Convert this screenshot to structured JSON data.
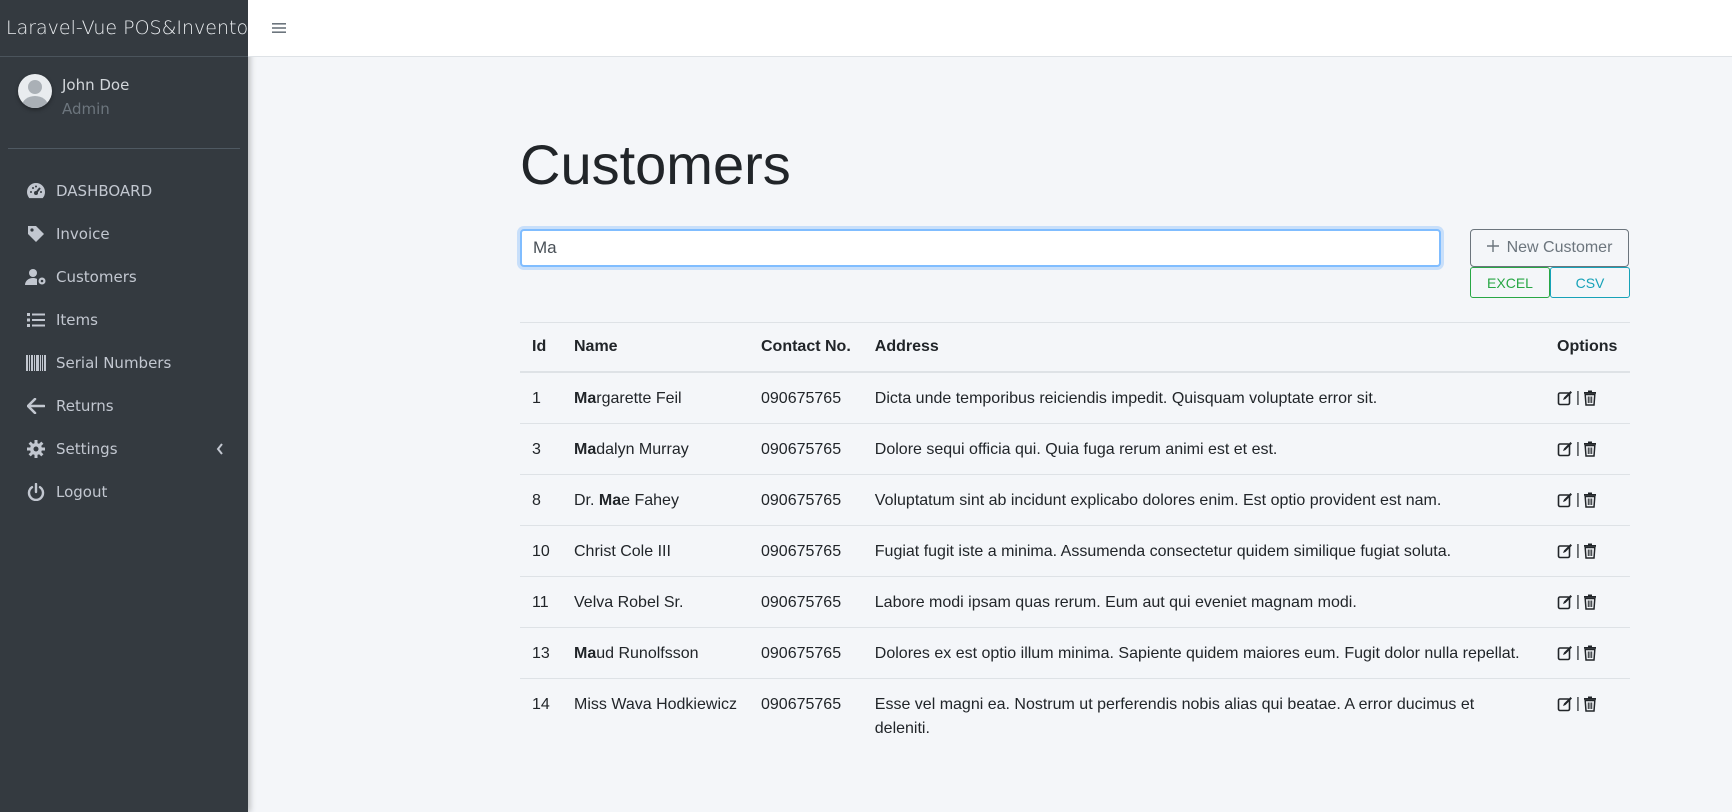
{
  "app": {
    "brand": "Laravel-Vue POS&Inventory"
  },
  "user": {
    "name": "John Doe",
    "role": "Admin"
  },
  "sidebar": {
    "items": [
      {
        "label": "DASHBOARD",
        "icon": "tachometer-icon"
      },
      {
        "label": "Invoice",
        "icon": "tag-icon"
      },
      {
        "label": "Customers",
        "icon": "user-cog-icon"
      },
      {
        "label": "Items",
        "icon": "list-icon"
      },
      {
        "label": "Serial Numbers",
        "icon": "barcode-icon"
      },
      {
        "label": "Returns",
        "icon": "arrow-left-icon"
      },
      {
        "label": "Settings",
        "icon": "gear-icon"
      },
      {
        "label": "Logout",
        "icon": "power-icon"
      }
    ]
  },
  "main": {
    "title": "Customers",
    "search_value": "Ma",
    "new_button": "New Customer",
    "excel_button": "EXCEL",
    "csv_button": "CSV"
  },
  "table": {
    "headers": [
      "Id",
      "Name",
      "Contact No.",
      "Address",
      "Options"
    ],
    "rows": [
      {
        "id": "1",
        "name_pre": "",
        "name_match": "Ma",
        "name_post": "rgarette Feil",
        "contact": "090675765",
        "address": "Dicta unde temporibus reiciendis impedit. Quisquam voluptate error sit."
      },
      {
        "id": "3",
        "name_pre": "",
        "name_match": "Ma",
        "name_post": "dalyn Murray",
        "contact": "090675765",
        "address": "Dolore sequi officia qui. Quia fuga rerum animi est et est."
      },
      {
        "id": "8",
        "name_pre": "Dr. ",
        "name_match": "Ma",
        "name_post": "e Fahey",
        "contact": "090675765",
        "address": "Voluptatum sint ab incidunt explicabo dolores enim. Est optio provident est nam."
      },
      {
        "id": "10",
        "name_pre": "Christ Cole III",
        "name_match": "",
        "name_post": "",
        "contact": "090675765",
        "address": "Fugiat fugit iste a minima. Assumenda consectetur quidem similique fugiat soluta."
      },
      {
        "id": "11",
        "name_pre": "Velva Robel Sr.",
        "name_match": "",
        "name_post": "",
        "contact": "090675765",
        "address": "Labore modi ipsam quas rerum. Eum aut qui eveniet magnam modi."
      },
      {
        "id": "13",
        "name_pre": "",
        "name_match": "Ma",
        "name_post": "ud Runolfsson",
        "contact": "090675765",
        "address": "Dolores ex est optio illum minima. Sapiente quidem maiores eum. Fugit dolor nulla repellat."
      },
      {
        "id": "14",
        "name_pre": "Miss Wava Hodkiewicz",
        "name_match": "",
        "name_post": "",
        "contact": "090675765",
        "address": "Esse vel magni ea. Nostrum ut perferendis nobis alias qui beatae. A error ducimus et deleniti."
      }
    ],
    "separator": "|"
  }
}
